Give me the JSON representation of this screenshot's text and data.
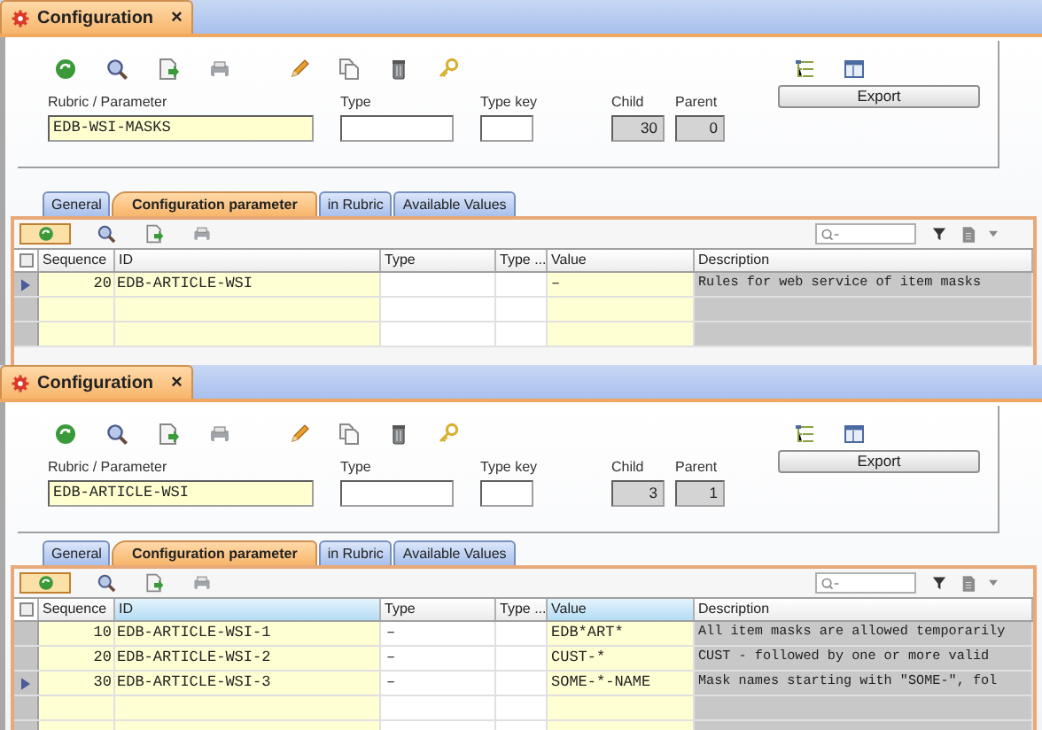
{
  "panels": [
    {
      "title": "Configuration",
      "close": "×",
      "rubric_label": "Rubric / Parameter",
      "rubric_value": "EDB-WSI-MASKS",
      "select_all": {
        "checked": false
      },
      "type_label": "Type",
      "type_key_label": "Type key",
      "child_label": "Child",
      "child_value": "30",
      "parent_label": "Parent",
      "parent_value": "0",
      "export_label": "Export",
      "tabs": [
        {
          "label": "General",
          "selected": false
        },
        {
          "label": "Configuration parameter",
          "selected": true
        },
        {
          "label": "in Rubric",
          "selected": false
        },
        {
          "label": "Available Values",
          "selected": false
        }
      ],
      "columns": [
        {
          "label": "Sequence",
          "highlighted": false
        },
        {
          "label": "ID",
          "highlighted": false
        },
        {
          "label": "Type",
          "highlighted": false
        },
        {
          "label": "Type ...",
          "highlighted": false
        },
        {
          "label": "Value",
          "highlighted": false
        },
        {
          "label": "Description",
          "highlighted": false
        }
      ],
      "rows": [
        {
          "sequence": "20",
          "id": "EDB-ARTICLE-WSI",
          "value": "–",
          "description": "Rules for web service of item masks",
          "selected": true
        }
      ]
    },
    {
      "title": "Configuration",
      "close": "×",
      "rubric_label": "Rubric / Parameter",
      "rubric_value": "EDB-ARTICLE-WSI",
      "select_all": {
        "checked": false
      },
      "type_label": "Type",
      "type_key_label": "Type key",
      "child_label": "Child",
      "child_value": "3",
      "parent_label": "Parent",
      "parent_value": "1",
      "export_label": "Export",
      "tabs": [
        {
          "label": "General",
          "selected": false
        },
        {
          "label": "Configuration parameter",
          "selected": true
        },
        {
          "label": "in Rubric",
          "selected": false
        },
        {
          "label": "Available Values",
          "selected": false
        }
      ],
      "columns": [
        {
          "label": "Sequence",
          "highlighted": false
        },
        {
          "label": "ID",
          "highlighted": true
        },
        {
          "label": "Type",
          "highlighted": false
        },
        {
          "label": "Type ...",
          "highlighted": false
        },
        {
          "label": "Value",
          "highlighted": true
        },
        {
          "label": "Description",
          "highlighted": false
        }
      ],
      "rows": [
        {
          "sequence": "10",
          "id": "EDB-ARTICLE-WSI-1",
          "type": "–",
          "value": "EDB*ART*",
          "description": "All item masks are allowed temporarily",
          "selected": false
        },
        {
          "sequence": "20",
          "id": "EDB-ARTICLE-WSI-2",
          "type": "–",
          "value": "CUST-*",
          "description": "CUST - followed by one or more valid",
          "selected": false
        },
        {
          "sequence": "30",
          "id": "EDB-ARTICLE-WSI-3",
          "type": "–",
          "value": "SOME-*-NAME",
          "description": "Mask names starting with \"SOME-\", fol",
          "selected": true
        }
      ]
    }
  ]
}
